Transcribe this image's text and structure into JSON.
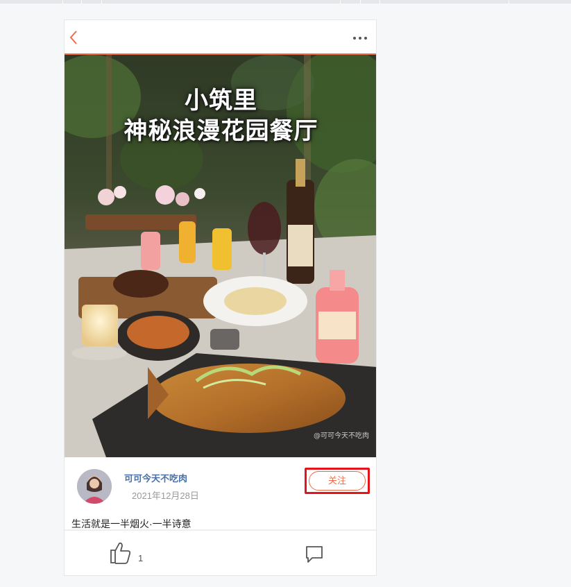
{
  "post": {
    "image_title_line1": "小筑里",
    "image_title_line2": "神秘浪漫花园餐厅",
    "image_watermark": "@可可今天不吃肉"
  },
  "author": {
    "name": "可可今天不吃肉",
    "date": "2021年12月28日",
    "follow_label": "关注"
  },
  "content": {
    "text": "生活就是一半烟火·一半诗意"
  },
  "footer": {
    "like_count": "1"
  },
  "icons": {
    "back": "chevron-left-icon",
    "more": "more-dots-icon",
    "like": "thumbs-up-icon",
    "comment": "comment-icon"
  },
  "colors": {
    "accent": "#f06b4a",
    "highlight_box": "#e3151a",
    "author_name": "#4a6fa5",
    "date": "#999999"
  }
}
